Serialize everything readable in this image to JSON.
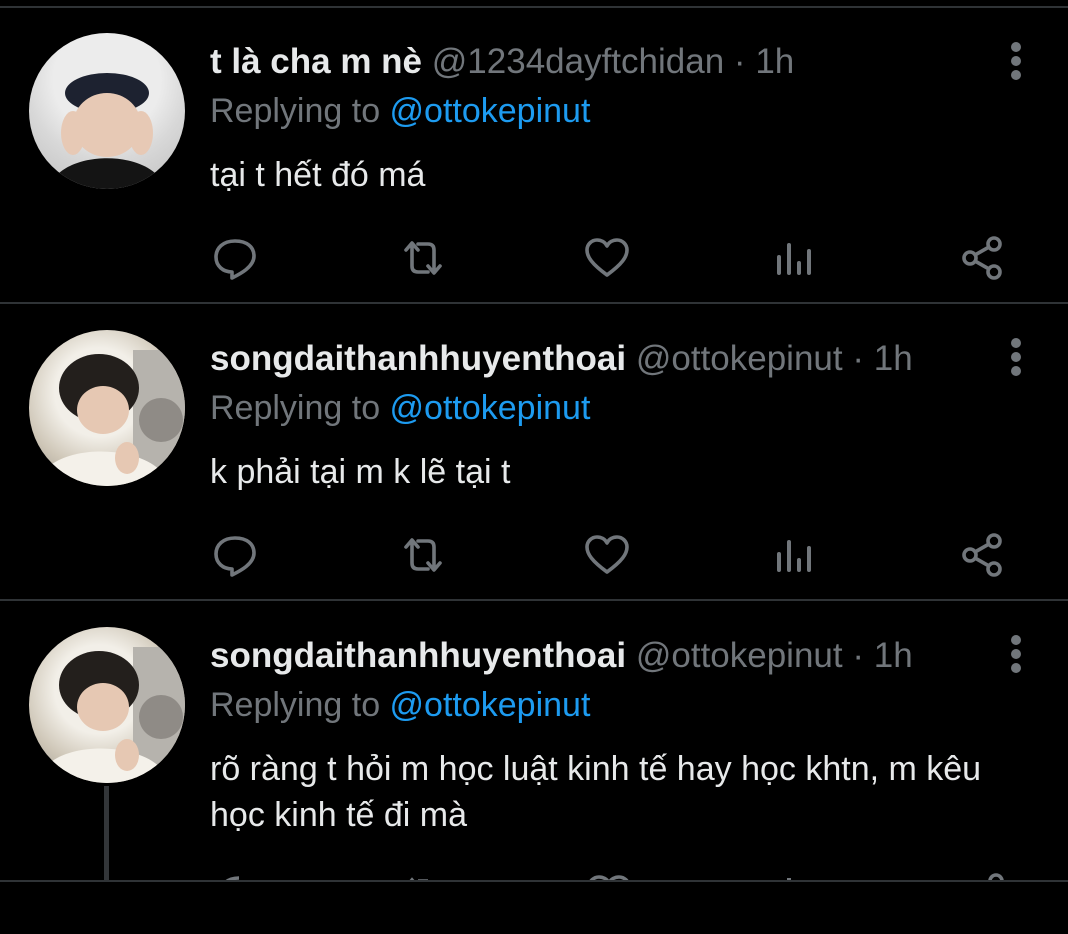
{
  "tweets": [
    {
      "name": "t là cha m nè",
      "handle": "@1234dayftchidan",
      "dot": "·",
      "time": "1h",
      "replying_prefix": "Replying to ",
      "replying_to": "@ottokepinut",
      "text": "tại t hết đó má"
    },
    {
      "name": "songdaithanhhuyenthoai",
      "handle": "@ottokepinut",
      "dot": "·",
      "time": "1h",
      "replying_prefix": "Replying to ",
      "replying_to": "@ottokepinut",
      "text": "k phải tại m k lẽ tại t"
    },
    {
      "name": "songdaithanhhuyenthoai",
      "handle": "@ottokepinut",
      "dot": "·",
      "time": "1h",
      "replying_prefix": "Replying to ",
      "replying_to": "@ottokepinut",
      "text": "rõ ràng t hỏi m học luật kinh tế hay học khtn, m kêu học kinh tế đi mà"
    }
  ],
  "icons": {
    "reply": "reply-icon",
    "retweet": "retweet-icon",
    "like": "like-icon",
    "analytics": "analytics-icon",
    "share": "share-icon",
    "more": "more-vertical-icon"
  },
  "colors": {
    "background": "#000000",
    "text": "#e7e9ea",
    "muted": "#71767b",
    "link": "#1d9bf0",
    "divider": "#2f3336"
  }
}
